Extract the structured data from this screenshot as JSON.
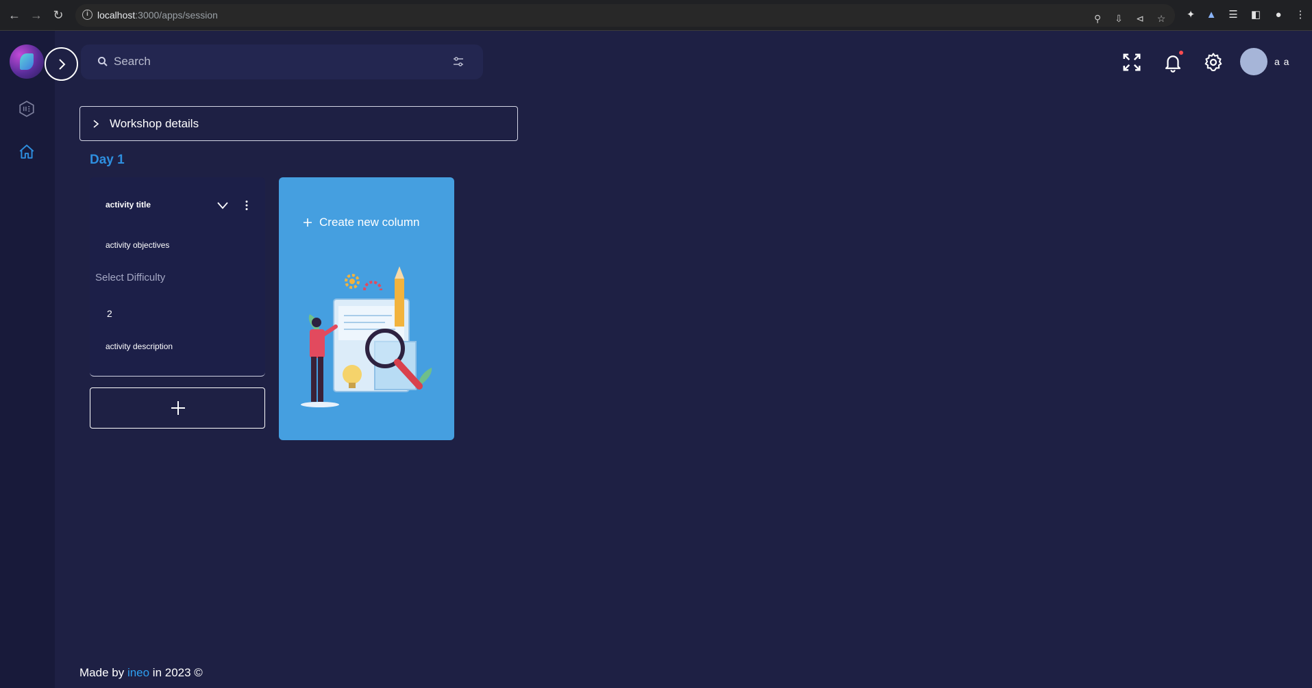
{
  "browser": {
    "url_host": "localhost",
    "url_path": ":3000/apps/session"
  },
  "search": {
    "placeholder": "Search"
  },
  "user": {
    "name": "a a"
  },
  "workshop": {
    "title": "Workshop details"
  },
  "day": {
    "label": "Day 1"
  },
  "activity": {
    "title": "activity title",
    "objectives": "activity objectives",
    "difficulty_label": "Select Difficulty",
    "difficulty_value": "2",
    "description": "activity description"
  },
  "create_column": {
    "label": "Create new column"
  },
  "footer": {
    "prefix": "Made by ",
    "brand": "ineo",
    "suffix": " in 2023 ©"
  },
  "colors": {
    "background": "#1e2044",
    "sidebar": "#181a3a",
    "accent": "#2e8fe0",
    "create_card": "#459fe0",
    "notification_dot": "#ff4c51"
  },
  "icons": {
    "browser": [
      "back-icon",
      "forward-icon",
      "reload-icon",
      "info-icon",
      "key-icon",
      "install-icon",
      "share-icon",
      "star-icon",
      "extensions-icon",
      "flask-icon",
      "media-icon",
      "sidepanel-icon",
      "profile-icon",
      "kebab-icon"
    ],
    "sidebar": [
      "app-logo",
      "apps-icon",
      "home-icon"
    ],
    "header": [
      "sidebar-toggle-icon",
      "search-icon",
      "filter-icon",
      "fullscreen-icon",
      "bell-icon",
      "gear-icon"
    ]
  }
}
